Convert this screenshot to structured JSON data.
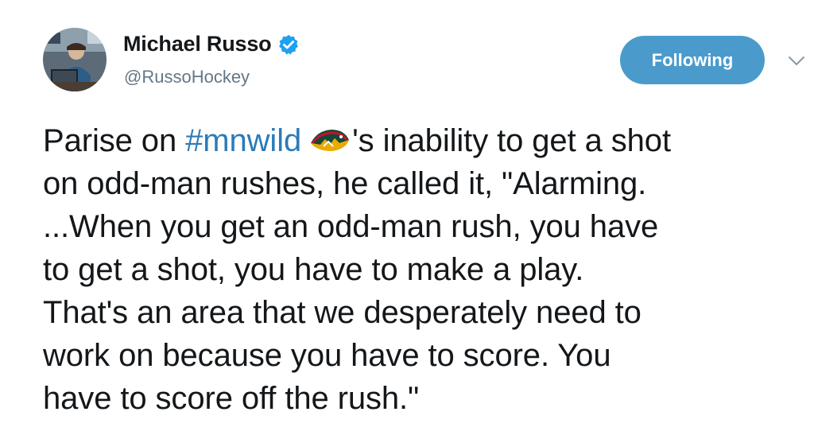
{
  "author": {
    "display_name": "Michael Russo",
    "handle": "@RussoHockey",
    "verified": true,
    "avatar_icon": "profile-photo"
  },
  "follow_button": {
    "label": "Following",
    "color": "#4a9bcc"
  },
  "menu_icon": "chevron-down-icon",
  "tweet": {
    "line1_prefix": "Parise on ",
    "hashtag": "#mnwild",
    "hashtag_color": "#2b7bb9",
    "emoji_icon": "minnesota-wild-logo",
    "line1_suffix": "'s inability to get a shot",
    "line2": "on odd-man rushes, he called it, \"Alarming.",
    "line3": "...When you get an odd-man rush, you have",
    "line4": "to get a shot, you have to make a play.",
    "line5": "That's an area that we desperately need to",
    "line6": "work on because you have to score. You",
    "line7": "have to score off the rush.\""
  }
}
